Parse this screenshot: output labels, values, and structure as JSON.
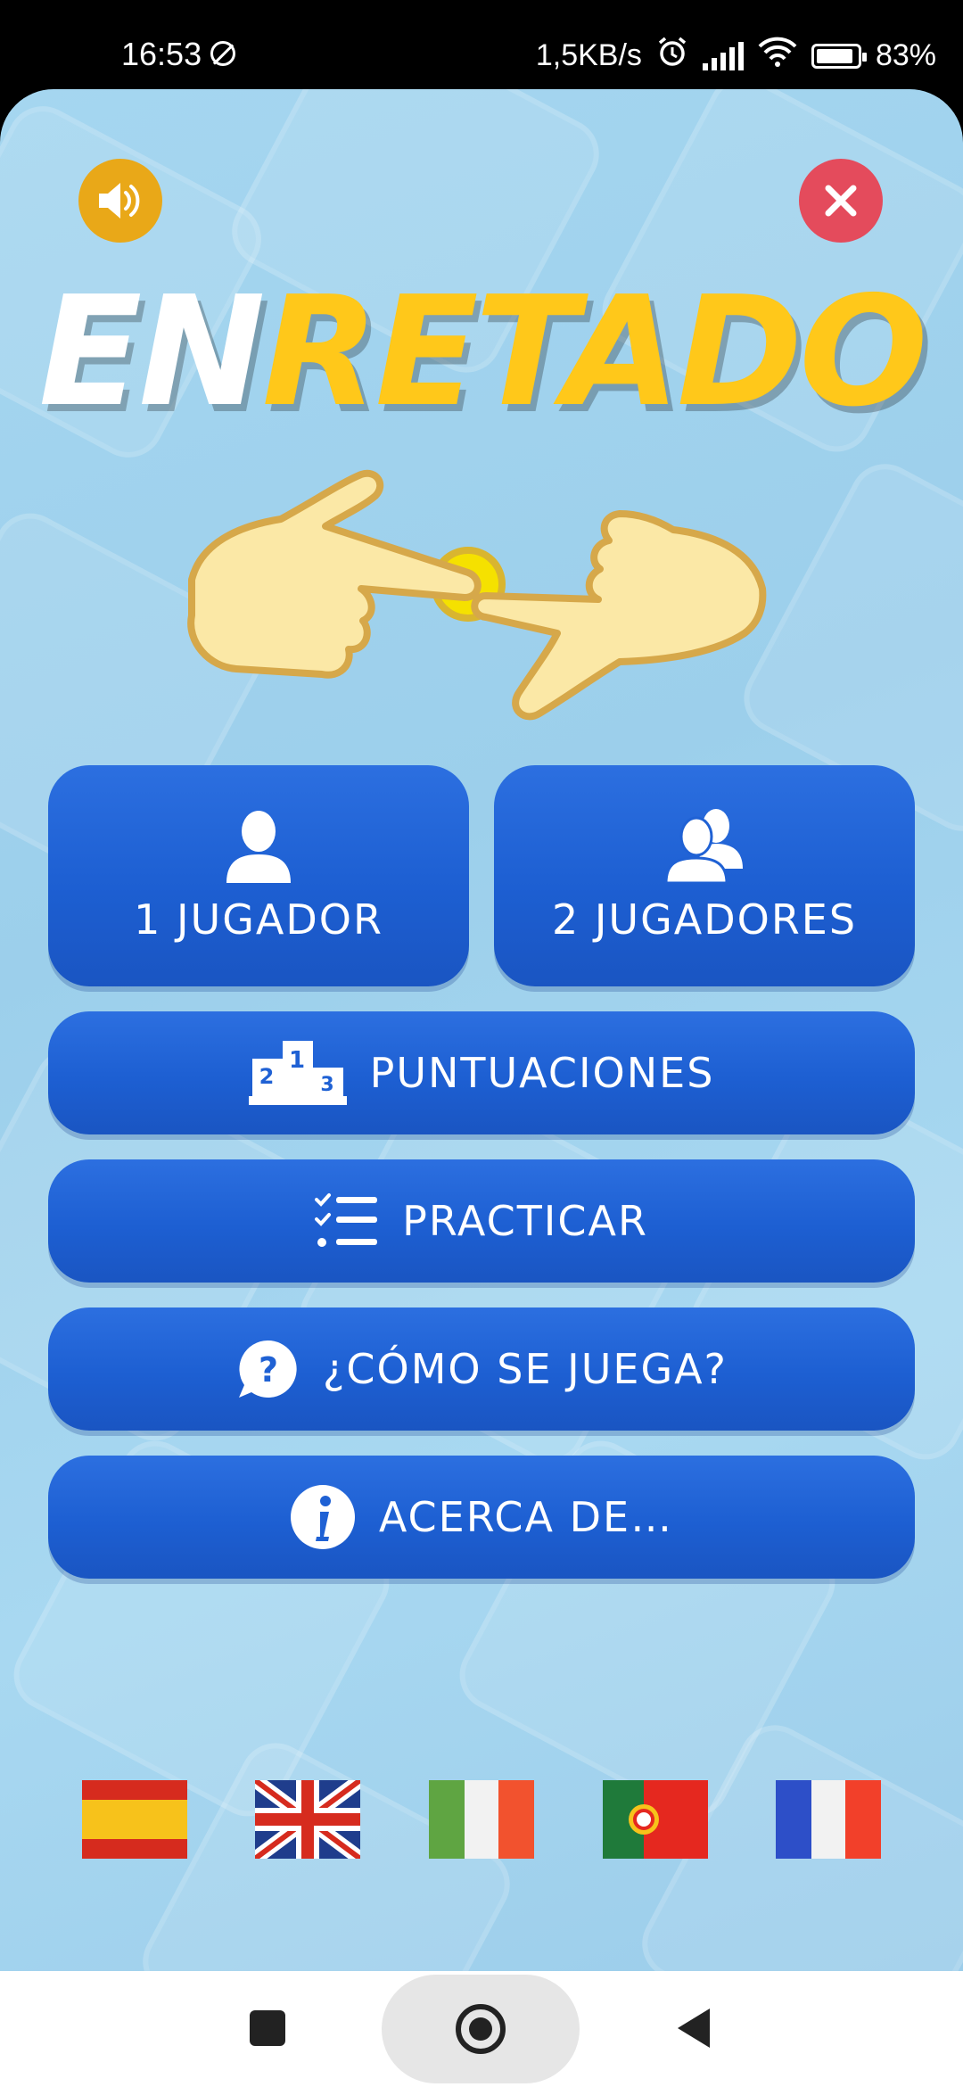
{
  "status_bar": {
    "time": "16:53",
    "speed": "1,5KB/s",
    "battery": "83%",
    "icons": [
      "dnd-off-icon",
      "alarm-icon",
      "signal-icon",
      "wifi-icon",
      "battery-icon"
    ]
  },
  "header": {
    "sound_icon": "speaker-icon",
    "close_icon": "close-icon"
  },
  "logo": {
    "part1": "EN",
    "part2": "RETADO"
  },
  "menu": {
    "one_player": {
      "label": "1 JUGADOR",
      "icon": "user-icon"
    },
    "two_players": {
      "label": "2 JUGADORES",
      "icon": "users-icon"
    },
    "scores": {
      "label": "PUNTUACIONES",
      "icon": "podium-icon"
    },
    "practice": {
      "label": "PRACTICAR",
      "icon": "checklist-icon"
    },
    "how_to_play": {
      "label": "¿CÓMO SE JUEGA?",
      "icon": "question-bubble-icon"
    },
    "about": {
      "label": "ACERCA DE…",
      "icon": "info-icon"
    }
  },
  "languages": [
    "flag-spain-icon",
    "flag-uk-icon",
    "flag-italy-icon",
    "flag-portugal-icon",
    "flag-france-icon"
  ],
  "colors": {
    "background": "#9ccfeb",
    "button": "#1f61d4",
    "logo_yellow": "#ffc81a",
    "sound_button": "#e9a818",
    "close_button": "#e44b5c"
  }
}
